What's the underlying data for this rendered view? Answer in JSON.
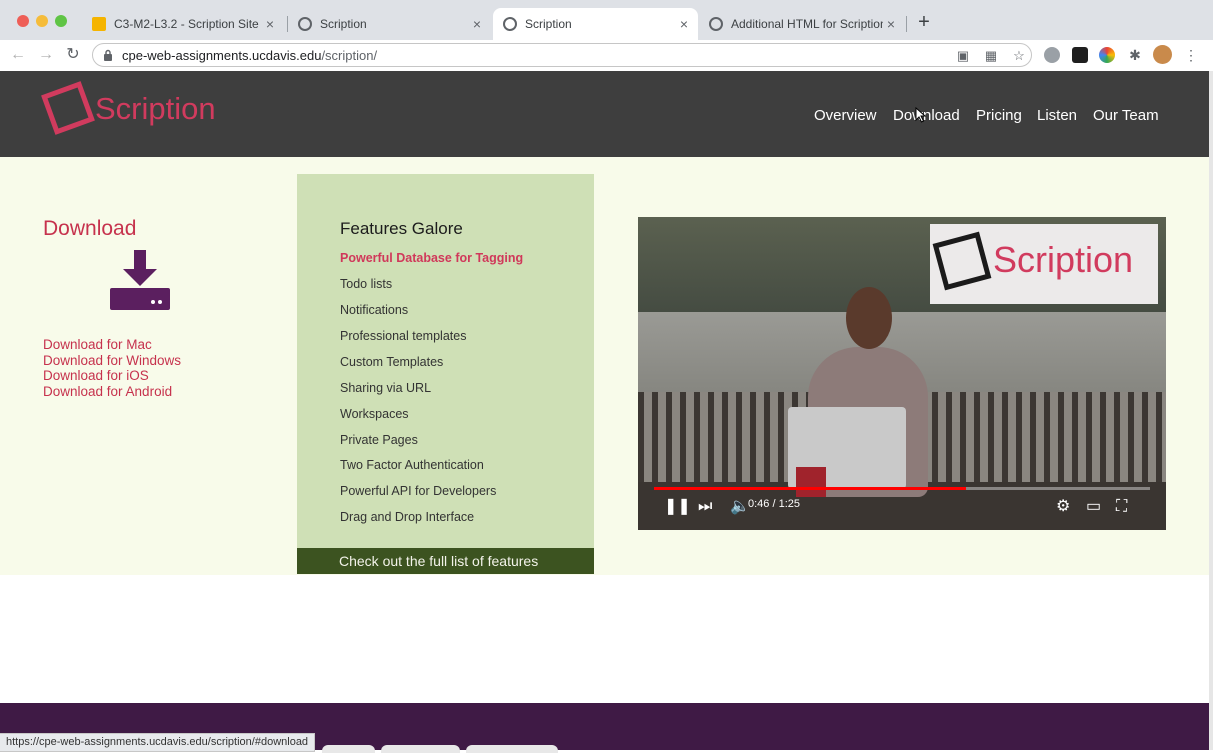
{
  "browser": {
    "tabs": [
      {
        "title": "C3-M2-L3.2 - Scription Site - ",
        "icon_color": "#f5b400",
        "active": false
      },
      {
        "title": "Scription",
        "icon_color": "#5f6368",
        "active": false
      },
      {
        "title": "Scription",
        "icon_color": "#5f6368",
        "active": true
      },
      {
        "title": "Additional HTML for Scription",
        "icon_color": "#5f6368",
        "active": false
      }
    ],
    "close_glyph": "×",
    "new_tab_glyph": "+",
    "url_host": "cpe-web-assignments.ucdavis.edu",
    "url_path": "/scription/",
    "status_url": "https://cpe-web-assignments.ucdavis.edu/scription/#download"
  },
  "site": {
    "logo_text": "Scription",
    "brand_color": "#d13b5e",
    "nav": [
      "Overview",
      "Download",
      "Pricing",
      "Listen",
      "Our Team"
    ]
  },
  "download": {
    "title": "Download",
    "links": [
      "Download for Mac",
      "Download for Windows",
      "Download for iOS",
      "Download for Android"
    ]
  },
  "features": {
    "title": "Features Galore",
    "items": [
      "Powerful Database for Tagging",
      "Todo lists",
      "Notifications",
      "Professional templates",
      "Custom Templates",
      "Sharing via URL",
      "Workspaces",
      "Private Pages",
      "Two Factor Authentication",
      "Powerful API for Developers",
      "Drag and Drop Interface"
    ],
    "cta": "Check out the full list of features"
  },
  "video": {
    "logo_text": "Scription",
    "time": "0:46 / 1:25",
    "progress": 0.63
  }
}
